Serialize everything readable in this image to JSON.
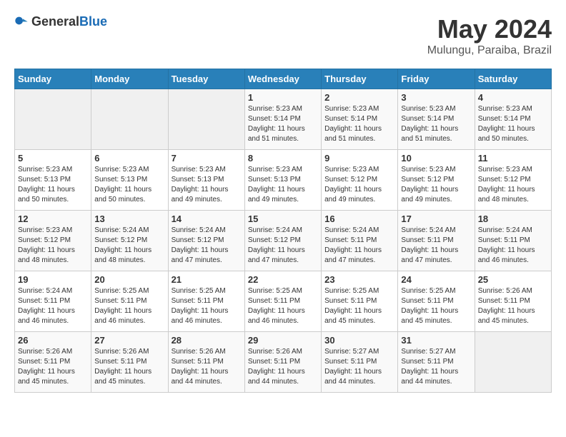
{
  "header": {
    "logo_general": "General",
    "logo_blue": "Blue",
    "month": "May 2024",
    "location": "Mulungu, Paraiba, Brazil"
  },
  "days_of_week": [
    "Sunday",
    "Monday",
    "Tuesday",
    "Wednesday",
    "Thursday",
    "Friday",
    "Saturday"
  ],
  "weeks": [
    [
      {
        "day": "",
        "info": ""
      },
      {
        "day": "",
        "info": ""
      },
      {
        "day": "",
        "info": ""
      },
      {
        "day": "1",
        "info": "Sunrise: 5:23 AM\nSunset: 5:14 PM\nDaylight: 11 hours\nand 51 minutes."
      },
      {
        "day": "2",
        "info": "Sunrise: 5:23 AM\nSunset: 5:14 PM\nDaylight: 11 hours\nand 51 minutes."
      },
      {
        "day": "3",
        "info": "Sunrise: 5:23 AM\nSunset: 5:14 PM\nDaylight: 11 hours\nand 51 minutes."
      },
      {
        "day": "4",
        "info": "Sunrise: 5:23 AM\nSunset: 5:14 PM\nDaylight: 11 hours\nand 50 minutes."
      }
    ],
    [
      {
        "day": "5",
        "info": "Sunrise: 5:23 AM\nSunset: 5:13 PM\nDaylight: 11 hours\nand 50 minutes."
      },
      {
        "day": "6",
        "info": "Sunrise: 5:23 AM\nSunset: 5:13 PM\nDaylight: 11 hours\nand 50 minutes."
      },
      {
        "day": "7",
        "info": "Sunrise: 5:23 AM\nSunset: 5:13 PM\nDaylight: 11 hours\nand 49 minutes."
      },
      {
        "day": "8",
        "info": "Sunrise: 5:23 AM\nSunset: 5:13 PM\nDaylight: 11 hours\nand 49 minutes."
      },
      {
        "day": "9",
        "info": "Sunrise: 5:23 AM\nSunset: 5:12 PM\nDaylight: 11 hours\nand 49 minutes."
      },
      {
        "day": "10",
        "info": "Sunrise: 5:23 AM\nSunset: 5:12 PM\nDaylight: 11 hours\nand 49 minutes."
      },
      {
        "day": "11",
        "info": "Sunrise: 5:23 AM\nSunset: 5:12 PM\nDaylight: 11 hours\nand 48 minutes."
      }
    ],
    [
      {
        "day": "12",
        "info": "Sunrise: 5:23 AM\nSunset: 5:12 PM\nDaylight: 11 hours\nand 48 minutes."
      },
      {
        "day": "13",
        "info": "Sunrise: 5:24 AM\nSunset: 5:12 PM\nDaylight: 11 hours\nand 48 minutes."
      },
      {
        "day": "14",
        "info": "Sunrise: 5:24 AM\nSunset: 5:12 PM\nDaylight: 11 hours\nand 47 minutes."
      },
      {
        "day": "15",
        "info": "Sunrise: 5:24 AM\nSunset: 5:12 PM\nDaylight: 11 hours\nand 47 minutes."
      },
      {
        "day": "16",
        "info": "Sunrise: 5:24 AM\nSunset: 5:11 PM\nDaylight: 11 hours\nand 47 minutes."
      },
      {
        "day": "17",
        "info": "Sunrise: 5:24 AM\nSunset: 5:11 PM\nDaylight: 11 hours\nand 47 minutes."
      },
      {
        "day": "18",
        "info": "Sunrise: 5:24 AM\nSunset: 5:11 PM\nDaylight: 11 hours\nand 46 minutes."
      }
    ],
    [
      {
        "day": "19",
        "info": "Sunrise: 5:24 AM\nSunset: 5:11 PM\nDaylight: 11 hours\nand 46 minutes."
      },
      {
        "day": "20",
        "info": "Sunrise: 5:25 AM\nSunset: 5:11 PM\nDaylight: 11 hours\nand 46 minutes."
      },
      {
        "day": "21",
        "info": "Sunrise: 5:25 AM\nSunset: 5:11 PM\nDaylight: 11 hours\nand 46 minutes."
      },
      {
        "day": "22",
        "info": "Sunrise: 5:25 AM\nSunset: 5:11 PM\nDaylight: 11 hours\nand 46 minutes."
      },
      {
        "day": "23",
        "info": "Sunrise: 5:25 AM\nSunset: 5:11 PM\nDaylight: 11 hours\nand 45 minutes."
      },
      {
        "day": "24",
        "info": "Sunrise: 5:25 AM\nSunset: 5:11 PM\nDaylight: 11 hours\nand 45 minutes."
      },
      {
        "day": "25",
        "info": "Sunrise: 5:26 AM\nSunset: 5:11 PM\nDaylight: 11 hours\nand 45 minutes."
      }
    ],
    [
      {
        "day": "26",
        "info": "Sunrise: 5:26 AM\nSunset: 5:11 PM\nDaylight: 11 hours\nand 45 minutes."
      },
      {
        "day": "27",
        "info": "Sunrise: 5:26 AM\nSunset: 5:11 PM\nDaylight: 11 hours\nand 45 minutes."
      },
      {
        "day": "28",
        "info": "Sunrise: 5:26 AM\nSunset: 5:11 PM\nDaylight: 11 hours\nand 44 minutes."
      },
      {
        "day": "29",
        "info": "Sunrise: 5:26 AM\nSunset: 5:11 PM\nDaylight: 11 hours\nand 44 minutes."
      },
      {
        "day": "30",
        "info": "Sunrise: 5:27 AM\nSunset: 5:11 PM\nDaylight: 11 hours\nand 44 minutes."
      },
      {
        "day": "31",
        "info": "Sunrise: 5:27 AM\nSunset: 5:11 PM\nDaylight: 11 hours\nand 44 minutes."
      },
      {
        "day": "",
        "info": ""
      }
    ]
  ]
}
